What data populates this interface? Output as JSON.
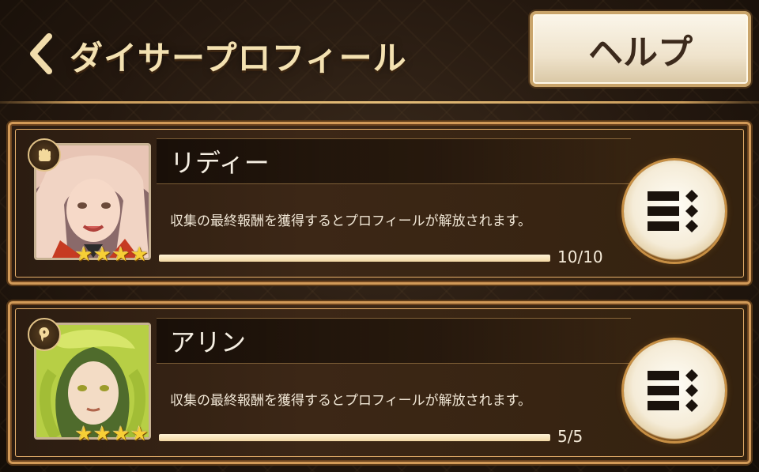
{
  "header": {
    "title": "ダイサープロフィール",
    "help_label": "ヘルプ"
  },
  "profiles": [
    {
      "name": "リディー",
      "description": "収集の最終報酬を獲得するとプロフィールが解放されます。",
      "progress_text": "10/10",
      "progress": 1.0,
      "stars": 4,
      "type_icon": "fist-icon"
    },
    {
      "name": "アリン",
      "description": "収集の最終報酬を獲得するとプロフィールが解放されます。",
      "progress_text": "5/5",
      "progress": 1.0,
      "stars": 4,
      "type_icon": "spirit-icon"
    }
  ],
  "colors": {
    "accent": "#d29a58",
    "title": "#f3e1b1",
    "star": "#f7cf36"
  }
}
